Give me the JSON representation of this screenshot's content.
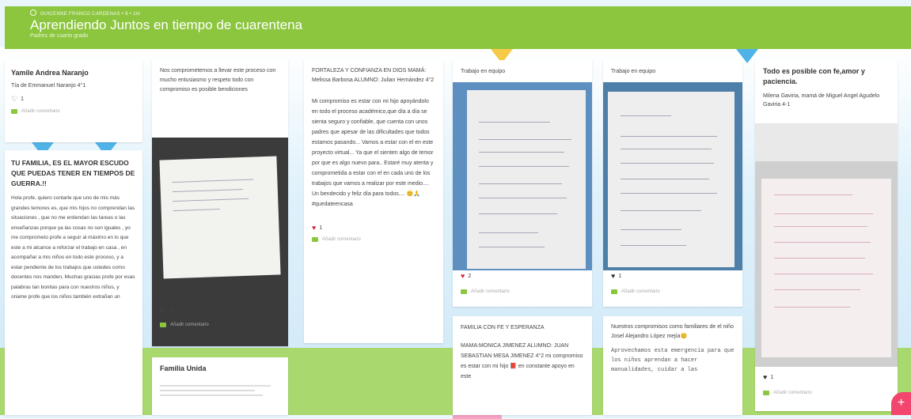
{
  "header": {
    "breadcrumb_user": "GUICENNE FRANCO CARDENAS",
    "breadcrumb_count": "• 8 •",
    "breadcrumb_time": "1m",
    "title": "Aprendiendo Juntos en tiempo de cuarentena",
    "subtitle": "Padres de cuarto grado"
  },
  "colors": {
    "header_green": "#8cc63f",
    "like_red": "#d7263d",
    "fab_pink": "#f2466f"
  },
  "posts": [
    {
      "title": "Yamile Andrea Naranjo",
      "sub": "Tía de Emmanuel Naranjo 4°1",
      "likes": "1",
      "comment": "Añadir comentario"
    },
    {
      "title": "TU FAMILIA, ES EL MAYOR ESCUDO QUE PUEDAS TENER EN TIEMPOS DE GUERRA.!!",
      "body": "Hola profe, quiero contarle que uno de mis más grandes temores es, que mis hijos no comprendan las situaciones , que no me entiendan las tareas o las enseñanzas porque ya las cosas no son iguales , yo me comprometo profe a seguir al máximo en lo que este a mi alcance a reforzar el trabajo en casa , en acompañar a mis niños en todo este proceso, y a estar pendiente de los trabajos que ustedes como docentes nos manden, Muchas gracias profe por esas palabras tan bonitas para con nuestros niños, y oriame profe que los niños también extrañan un"
    },
    {
      "body": "Nos comprometemos a llevar este proceso con mucho entusiasmo y respeto todo con compromiso es posible bendiciones",
      "likes": "1",
      "comment": "Añadir comentario"
    },
    {
      "title": "Familia Unida"
    },
    {
      "body_top": "FORTALEZA Y CONFIANZA EN DIOS MAMÁ: Melissa Barbosa ALUMNO: Julian Hernández 4°2",
      "body": "Mi compromiso es estar con mi hijo apoyándolo en todo el proceso académico,que día a día se sienta seguro y confiable, que cuenta con unos padres que apesar de las dificultades que todos estamos pasando... Vamos a estar con el en este proyecto virtual... Ya que el sienten algo de temor por que es algo nuevo para.. Estaré muy atenta y comprometida a estar con el en cada uno de los trabajos que vamos a realizar por este medio.... Un bendecido y feliz día para todos.... 😊🙏 #quedateencasa",
      "likes": "1",
      "comment": "Añadir comentario"
    },
    {
      "body": "Trabajo en equipo",
      "likes": "2",
      "comment": "Añadir comentario"
    },
    {
      "title": "FAMILIA CON FE Y ESPERANZA",
      "body": "MAMA:MONICA JIMENEZ ALUMNO: JUAN SEBASTIAN MESA JIMENEZ 4°2 mi compromiso es estar con mi hijo 📕 en constante apoyo en este"
    },
    {
      "body": "Trabajo en equipo",
      "likes": "1",
      "comment": "Añadir comentario"
    },
    {
      "body": "Nuestros compromisos como familiares de el niño Josel Alejandro López mejía😊",
      "body_mono": "Aprovechamos esta emergencia para que los niños aprendan a hacer manualidades, cuidar a las"
    },
    {
      "title": "Todo es posible con fe,amor y paciencia.",
      "sub": "Milena Gaviria, mamá de Miguel Angel Agudelo Gaviria 4-1",
      "likes": "1",
      "comment": "Añadir comentario"
    }
  ],
  "fab_label": "+"
}
